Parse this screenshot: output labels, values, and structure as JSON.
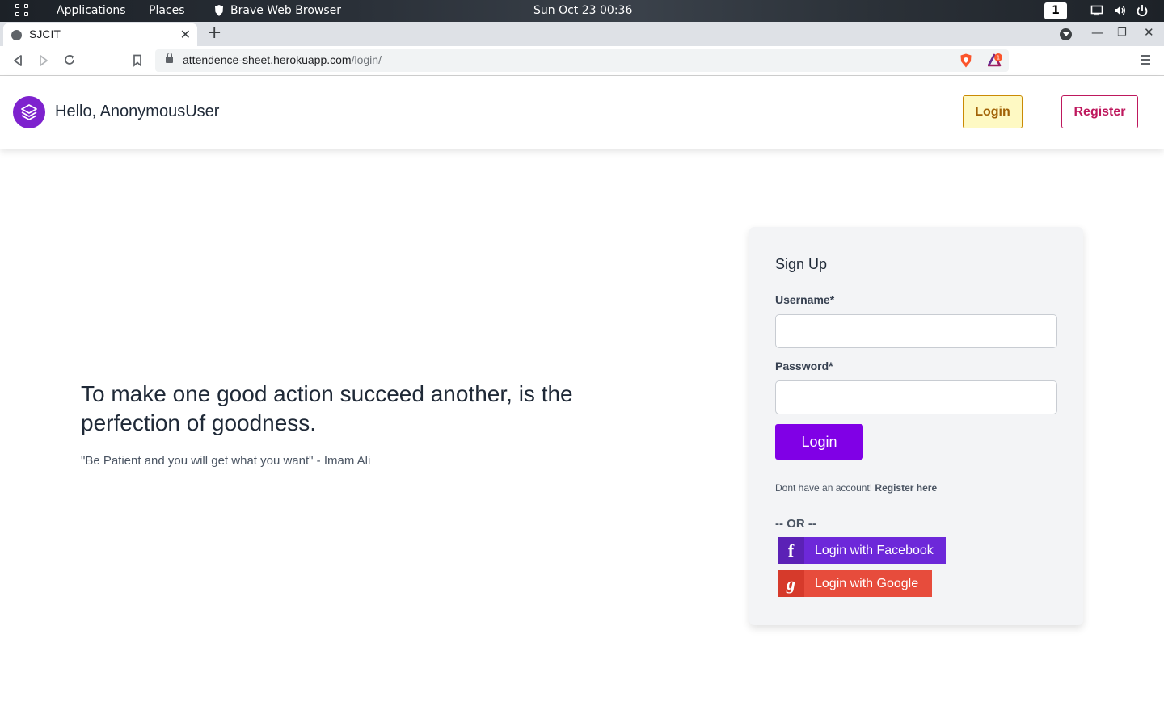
{
  "os_bar": {
    "applications": "Applications",
    "places": "Places",
    "active_app": "Brave Web Browser",
    "clock": "Sun Oct 23  00:36",
    "workspace": "1"
  },
  "browser": {
    "tab_title": "SJCIT",
    "url_host": "attendence-sheet.herokuapp.com",
    "url_path": "/login/",
    "rewards_badge": "1"
  },
  "header": {
    "greeting": "Hello, AnonymousUser",
    "login_label": "Login",
    "register_label": "Register"
  },
  "hero": {
    "quote": "To make one good action succeed another, is the perfection of goodness.",
    "subquote": "\"Be Patient and you will get what you want\" - Imam Ali"
  },
  "form": {
    "title": "Sign Up",
    "username_label": "Username*",
    "username_value": "",
    "password_label": "Password*",
    "password_value": "",
    "submit_label": "Login",
    "no_account_text": "Dont have an account! ",
    "register_link": "Register here",
    "or_text": "-- OR --",
    "facebook_label": "Login with Facebook",
    "google_label": "Login with Google"
  },
  "colors": {
    "primary": "#8000e6",
    "facebook": "#6d28d9",
    "google": "#e74c3c",
    "login_bg": "#fef9c3",
    "register_border": "#be185d"
  }
}
